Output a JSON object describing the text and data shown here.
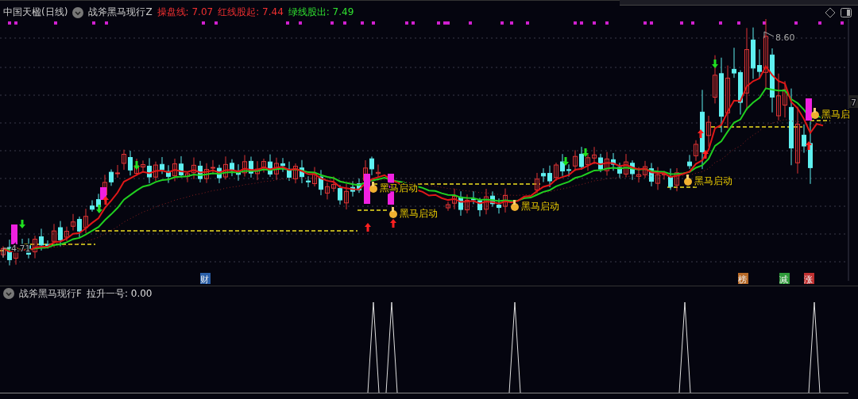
{
  "header": {
    "stock": "中国天楹(日线)",
    "indicator": "战斧黑马现行Z",
    "values": [
      {
        "text": "操盘线: 7.07",
        "color": "#f03030"
      },
      {
        "text": "红线股起: 7.44",
        "color": "#f03030"
      },
      {
        "text": "绿线股出: 7.49",
        "color": "#30e030"
      }
    ]
  },
  "price_labels": [
    {
      "kind": "high",
      "text": "8.60"
    },
    {
      "kind": "low",
      "text": "4.71"
    }
  ],
  "axis_label": "7",
  "signals": [
    {
      "text": "黑马启动"
    },
    {
      "text": "黑马启动"
    },
    {
      "text": "黑马启动"
    },
    {
      "text": "黑马启动"
    },
    {
      "text": "黑马启"
    }
  ],
  "event_tags": [
    {
      "text": "财",
      "color": "#2a5fa8"
    },
    {
      "text": "榜",
      "color": "#b86a28"
    },
    {
      "text": "减",
      "color": "#2f9a3a"
    },
    {
      "text": "涨",
      "color": "#c03030"
    }
  ],
  "sub_panel": {
    "indicator": "战斧黑马现行F",
    "value": "拉升一号: 0.00"
  }
}
